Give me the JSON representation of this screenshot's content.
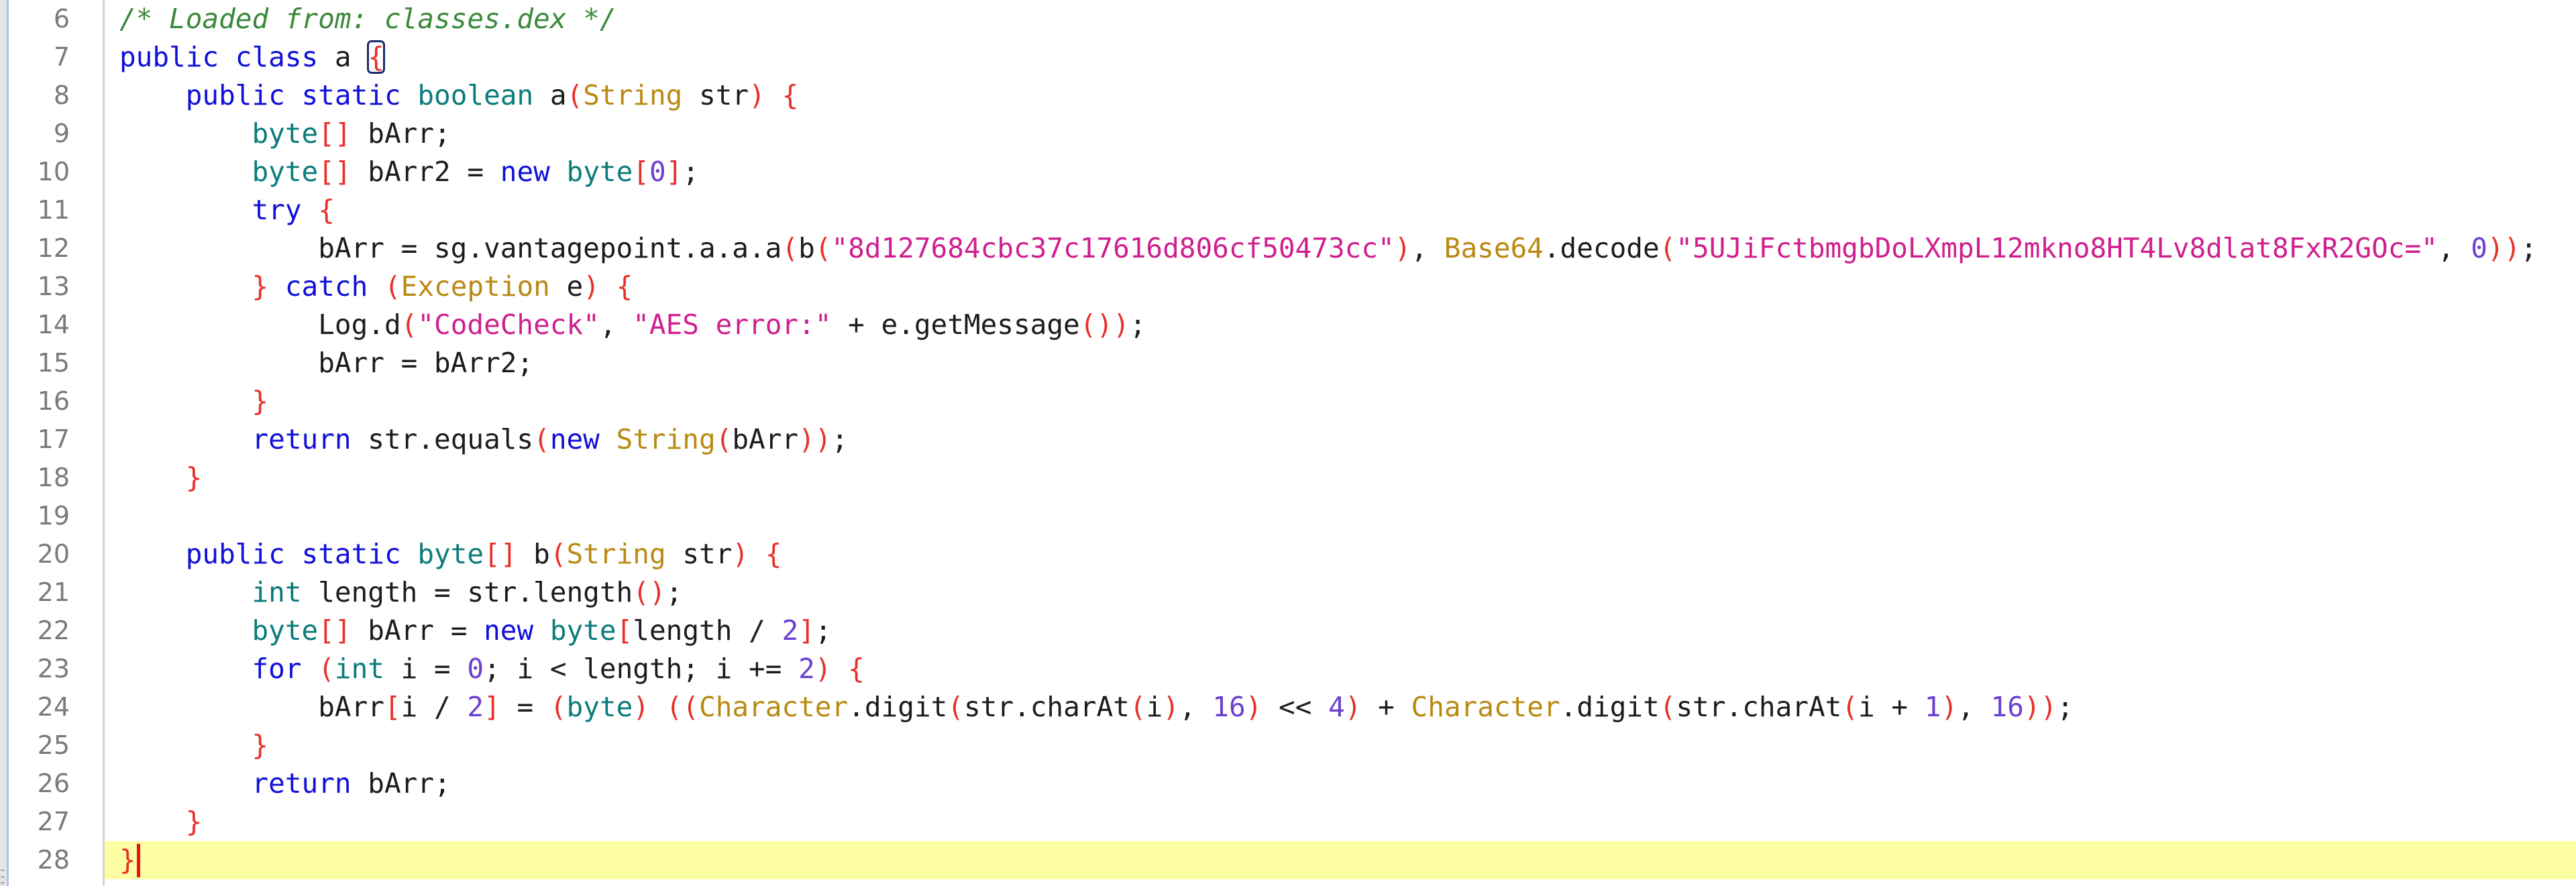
{
  "editor": {
    "language": "java",
    "current_line": 28,
    "matched_bracket_line": 7,
    "colors": {
      "keyword": "#1010d8",
      "type": "#0b7b7b",
      "comment": "#3b8a3b",
      "string": "#cf1f8f",
      "classref": "#b98a12",
      "number": "#6b3fd0",
      "bracket": "#e8302a",
      "current_line_highlight": "#fdfda4",
      "caret": "#ee1111"
    },
    "lines": [
      {
        "number": "6",
        "tokens": [
          {
            "t": "comment",
            "v": "/* Loaded from: classes.dex */"
          }
        ]
      },
      {
        "number": "7",
        "tokens": [
          {
            "t": "keyword",
            "v": "public"
          },
          {
            "t": "plain",
            "v": " "
          },
          {
            "t": "keyword",
            "v": "class"
          },
          {
            "t": "plain",
            "v": " a "
          },
          {
            "t": "bracket",
            "v": "{",
            "matched": true
          }
        ]
      },
      {
        "number": "8",
        "tokens": [
          {
            "t": "plain",
            "v": "    "
          },
          {
            "t": "keyword",
            "v": "public"
          },
          {
            "t": "plain",
            "v": " "
          },
          {
            "t": "keyword",
            "v": "static"
          },
          {
            "t": "plain",
            "v": " "
          },
          {
            "t": "type",
            "v": "boolean"
          },
          {
            "t": "plain",
            "v": " a"
          },
          {
            "t": "bracket",
            "v": "("
          },
          {
            "t": "classref",
            "v": "String"
          },
          {
            "t": "plain",
            "v": " str"
          },
          {
            "t": "bracket",
            "v": ")"
          },
          {
            "t": "plain",
            "v": " "
          },
          {
            "t": "bracket",
            "v": "{"
          }
        ]
      },
      {
        "number": "9",
        "tokens": [
          {
            "t": "plain",
            "v": "        "
          },
          {
            "t": "type",
            "v": "byte"
          },
          {
            "t": "bracket",
            "v": "[]"
          },
          {
            "t": "plain",
            "v": " bArr;"
          }
        ]
      },
      {
        "number": "10",
        "tokens": [
          {
            "t": "plain",
            "v": "        "
          },
          {
            "t": "type",
            "v": "byte"
          },
          {
            "t": "bracket",
            "v": "[]"
          },
          {
            "t": "plain",
            "v": " bArr2 = "
          },
          {
            "t": "keyword",
            "v": "new"
          },
          {
            "t": "plain",
            "v": " "
          },
          {
            "t": "type",
            "v": "byte"
          },
          {
            "t": "bracket",
            "v": "["
          },
          {
            "t": "number",
            "v": "0"
          },
          {
            "t": "bracket",
            "v": "]"
          },
          {
            "t": "plain",
            "v": ";"
          }
        ]
      },
      {
        "number": "11",
        "tokens": [
          {
            "t": "plain",
            "v": "        "
          },
          {
            "t": "keyword",
            "v": "try"
          },
          {
            "t": "plain",
            "v": " "
          },
          {
            "t": "bracket",
            "v": "{"
          }
        ]
      },
      {
        "number": "12",
        "tokens": [
          {
            "t": "plain",
            "v": "            bArr = sg.vantagepoint.a.a.a"
          },
          {
            "t": "bracket",
            "v": "("
          },
          {
            "t": "plain",
            "v": "b"
          },
          {
            "t": "bracket",
            "v": "("
          },
          {
            "t": "string",
            "v": "\"8d127684cbc37c17616d806cf50473cc\""
          },
          {
            "t": "bracket",
            "v": ")"
          },
          {
            "t": "plain",
            "v": ", "
          },
          {
            "t": "classref",
            "v": "Base64"
          },
          {
            "t": "plain",
            "v": ".decode"
          },
          {
            "t": "bracket",
            "v": "("
          },
          {
            "t": "string",
            "v": "\"5UJiFctbmgbDoLXmpL12mkno8HT4Lv8dlat8FxR2GOc=\""
          },
          {
            "t": "plain",
            "v": ", "
          },
          {
            "t": "number",
            "v": "0"
          },
          {
            "t": "bracket",
            "v": "))"
          },
          {
            "t": "plain",
            "v": ";"
          }
        ]
      },
      {
        "number": "13",
        "tokens": [
          {
            "t": "plain",
            "v": "        "
          },
          {
            "t": "bracket",
            "v": "}"
          },
          {
            "t": "plain",
            "v": " "
          },
          {
            "t": "keyword",
            "v": "catch"
          },
          {
            "t": "plain",
            "v": " "
          },
          {
            "t": "bracket",
            "v": "("
          },
          {
            "t": "classref",
            "v": "Exception"
          },
          {
            "t": "plain",
            "v": " e"
          },
          {
            "t": "bracket",
            "v": ")"
          },
          {
            "t": "plain",
            "v": " "
          },
          {
            "t": "bracket",
            "v": "{"
          }
        ]
      },
      {
        "number": "14",
        "tokens": [
          {
            "t": "plain",
            "v": "            Log.d"
          },
          {
            "t": "bracket",
            "v": "("
          },
          {
            "t": "string",
            "v": "\"CodeCheck\""
          },
          {
            "t": "plain",
            "v": ", "
          },
          {
            "t": "string",
            "v": "\"AES error:\""
          },
          {
            "t": "plain",
            "v": " + e.getMessage"
          },
          {
            "t": "bracket",
            "v": "())"
          },
          {
            "t": "plain",
            "v": ";"
          }
        ]
      },
      {
        "number": "15",
        "tokens": [
          {
            "t": "plain",
            "v": "            bArr = bArr2;"
          }
        ]
      },
      {
        "number": "16",
        "tokens": [
          {
            "t": "plain",
            "v": "        "
          },
          {
            "t": "bracket",
            "v": "}"
          }
        ]
      },
      {
        "number": "17",
        "tokens": [
          {
            "t": "plain",
            "v": "        "
          },
          {
            "t": "keyword",
            "v": "return"
          },
          {
            "t": "plain",
            "v": " str.equals"
          },
          {
            "t": "bracket",
            "v": "("
          },
          {
            "t": "keyword",
            "v": "new"
          },
          {
            "t": "plain",
            "v": " "
          },
          {
            "t": "classref",
            "v": "String"
          },
          {
            "t": "bracket",
            "v": "("
          },
          {
            "t": "plain",
            "v": "bArr"
          },
          {
            "t": "bracket",
            "v": "))"
          },
          {
            "t": "plain",
            "v": ";"
          }
        ]
      },
      {
        "number": "18",
        "tokens": [
          {
            "t": "plain",
            "v": "    "
          },
          {
            "t": "bracket",
            "v": "}"
          }
        ]
      },
      {
        "number": "19",
        "tokens": []
      },
      {
        "number": "20",
        "tokens": [
          {
            "t": "plain",
            "v": "    "
          },
          {
            "t": "keyword",
            "v": "public"
          },
          {
            "t": "plain",
            "v": " "
          },
          {
            "t": "keyword",
            "v": "static"
          },
          {
            "t": "plain",
            "v": " "
          },
          {
            "t": "type",
            "v": "byte"
          },
          {
            "t": "bracket",
            "v": "[]"
          },
          {
            "t": "plain",
            "v": " b"
          },
          {
            "t": "bracket",
            "v": "("
          },
          {
            "t": "classref",
            "v": "String"
          },
          {
            "t": "plain",
            "v": " str"
          },
          {
            "t": "bracket",
            "v": ")"
          },
          {
            "t": "plain",
            "v": " "
          },
          {
            "t": "bracket",
            "v": "{"
          }
        ]
      },
      {
        "number": "21",
        "tokens": [
          {
            "t": "plain",
            "v": "        "
          },
          {
            "t": "type",
            "v": "int"
          },
          {
            "t": "plain",
            "v": " length = str.length"
          },
          {
            "t": "bracket",
            "v": "()"
          },
          {
            "t": "plain",
            "v": ";"
          }
        ]
      },
      {
        "number": "22",
        "tokens": [
          {
            "t": "plain",
            "v": "        "
          },
          {
            "t": "type",
            "v": "byte"
          },
          {
            "t": "bracket",
            "v": "[]"
          },
          {
            "t": "plain",
            "v": " bArr = "
          },
          {
            "t": "keyword",
            "v": "new"
          },
          {
            "t": "plain",
            "v": " "
          },
          {
            "t": "type",
            "v": "byte"
          },
          {
            "t": "bracket",
            "v": "["
          },
          {
            "t": "plain",
            "v": "length / "
          },
          {
            "t": "number",
            "v": "2"
          },
          {
            "t": "bracket",
            "v": "]"
          },
          {
            "t": "plain",
            "v": ";"
          }
        ]
      },
      {
        "number": "23",
        "tokens": [
          {
            "t": "plain",
            "v": "        "
          },
          {
            "t": "keyword",
            "v": "for"
          },
          {
            "t": "plain",
            "v": " "
          },
          {
            "t": "bracket",
            "v": "("
          },
          {
            "t": "type",
            "v": "int"
          },
          {
            "t": "plain",
            "v": " i = "
          },
          {
            "t": "number",
            "v": "0"
          },
          {
            "t": "plain",
            "v": "; i < length; i += "
          },
          {
            "t": "number",
            "v": "2"
          },
          {
            "t": "bracket",
            "v": ")"
          },
          {
            "t": "plain",
            "v": " "
          },
          {
            "t": "bracket",
            "v": "{"
          }
        ]
      },
      {
        "number": "24",
        "tokens": [
          {
            "t": "plain",
            "v": "            bArr"
          },
          {
            "t": "bracket",
            "v": "["
          },
          {
            "t": "plain",
            "v": "i / "
          },
          {
            "t": "number",
            "v": "2"
          },
          {
            "t": "bracket",
            "v": "]"
          },
          {
            "t": "plain",
            "v": " = "
          },
          {
            "t": "bracket",
            "v": "("
          },
          {
            "t": "type",
            "v": "byte"
          },
          {
            "t": "bracket",
            "v": ")"
          },
          {
            "t": "plain",
            "v": " "
          },
          {
            "t": "bracket",
            "v": "(("
          },
          {
            "t": "classref",
            "v": "Character"
          },
          {
            "t": "plain",
            "v": ".digit"
          },
          {
            "t": "bracket",
            "v": "("
          },
          {
            "t": "plain",
            "v": "str.charAt"
          },
          {
            "t": "bracket",
            "v": "("
          },
          {
            "t": "plain",
            "v": "i"
          },
          {
            "t": "bracket",
            "v": ")"
          },
          {
            "t": "plain",
            "v": ", "
          },
          {
            "t": "number",
            "v": "16"
          },
          {
            "t": "bracket",
            "v": ")"
          },
          {
            "t": "plain",
            "v": " << "
          },
          {
            "t": "number",
            "v": "4"
          },
          {
            "t": "bracket",
            "v": ")"
          },
          {
            "t": "plain",
            "v": " + "
          },
          {
            "t": "classref",
            "v": "Character"
          },
          {
            "t": "plain",
            "v": ".digit"
          },
          {
            "t": "bracket",
            "v": "("
          },
          {
            "t": "plain",
            "v": "str.charAt"
          },
          {
            "t": "bracket",
            "v": "("
          },
          {
            "t": "plain",
            "v": "i + "
          },
          {
            "t": "number",
            "v": "1"
          },
          {
            "t": "bracket",
            "v": ")"
          },
          {
            "t": "plain",
            "v": ", "
          },
          {
            "t": "number",
            "v": "16"
          },
          {
            "t": "bracket",
            "v": "))"
          },
          {
            "t": "plain",
            "v": ";"
          }
        ]
      },
      {
        "number": "25",
        "tokens": [
          {
            "t": "plain",
            "v": "        "
          },
          {
            "t": "bracket",
            "v": "}"
          }
        ]
      },
      {
        "number": "26",
        "tokens": [
          {
            "t": "plain",
            "v": "        "
          },
          {
            "t": "keyword",
            "v": "return"
          },
          {
            "t": "plain",
            "v": " bArr;"
          }
        ]
      },
      {
        "number": "27",
        "tokens": [
          {
            "t": "plain",
            "v": "    "
          },
          {
            "t": "bracket",
            "v": "}"
          }
        ]
      },
      {
        "number": "28",
        "tokens": [
          {
            "t": "bracket",
            "v": "}"
          }
        ],
        "caret": true
      }
    ]
  }
}
